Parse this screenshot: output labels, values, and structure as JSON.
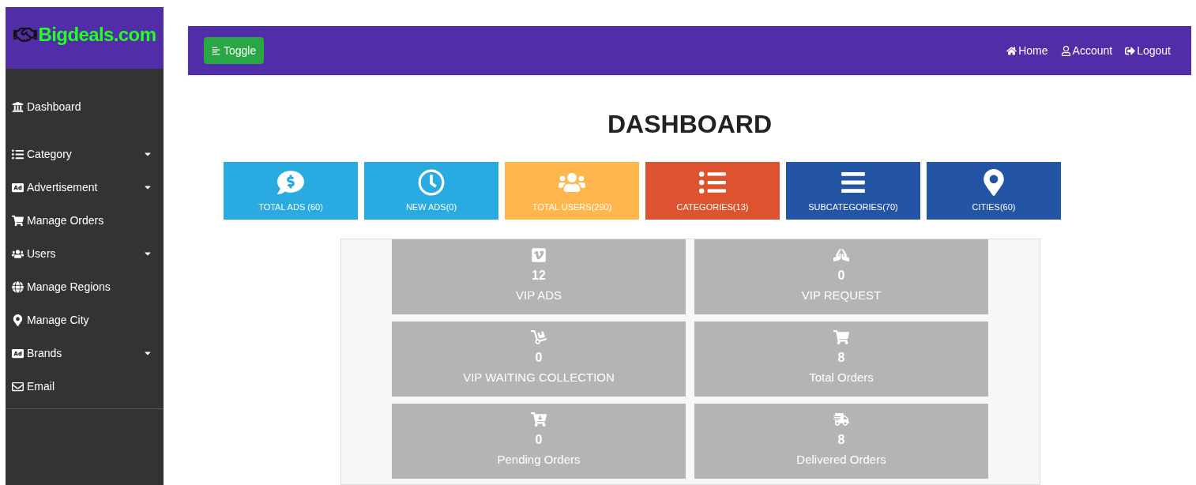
{
  "brand": "Bigdeals.com",
  "sidebar": {
    "items": [
      {
        "label": "Dashboard",
        "has_submenu": false
      },
      {
        "label": "Category",
        "has_submenu": true
      },
      {
        "label": "Advertisement",
        "has_submenu": true
      },
      {
        "label": "Manage Orders",
        "has_submenu": false
      },
      {
        "label": "Users",
        "has_submenu": true
      },
      {
        "label": "Manage Regions",
        "has_submenu": false
      },
      {
        "label": "Manage City",
        "has_submenu": false
      },
      {
        "label": "Brands",
        "has_submenu": true
      },
      {
        "label": "Email",
        "has_submenu": false
      }
    ]
  },
  "navbar": {
    "toggle": "Toggle",
    "links": [
      "Home",
      "Account",
      "Logout"
    ]
  },
  "title": "DASHBOARD",
  "tiles": [
    {
      "label": "TOTAL ADS (60)",
      "color": "#29abe2"
    },
    {
      "label": "NEW ADS(0)",
      "color": "#29abe2"
    },
    {
      "label": "TOTAL USERS(290)",
      "color": "#ffb74d"
    },
    {
      "label": "CATEGORIES(13)",
      "color": "#dd5330"
    },
    {
      "label": "SUBCATEGORIES(70)",
      "color": "#2355a4"
    },
    {
      "label": "CITIES(60)",
      "color": "#2355a4"
    }
  ],
  "stats": [
    {
      "value": "12",
      "label": "VIP ADS"
    },
    {
      "value": "0",
      "label": "VIP REQUEST"
    },
    {
      "value": "0",
      "label": "VIP WAITING COLLECTION"
    },
    {
      "value": "8",
      "label": "Total Orders"
    },
    {
      "value": "0",
      "label": "Pending Orders"
    },
    {
      "value": "8",
      "label": "Delivered Orders"
    }
  ]
}
